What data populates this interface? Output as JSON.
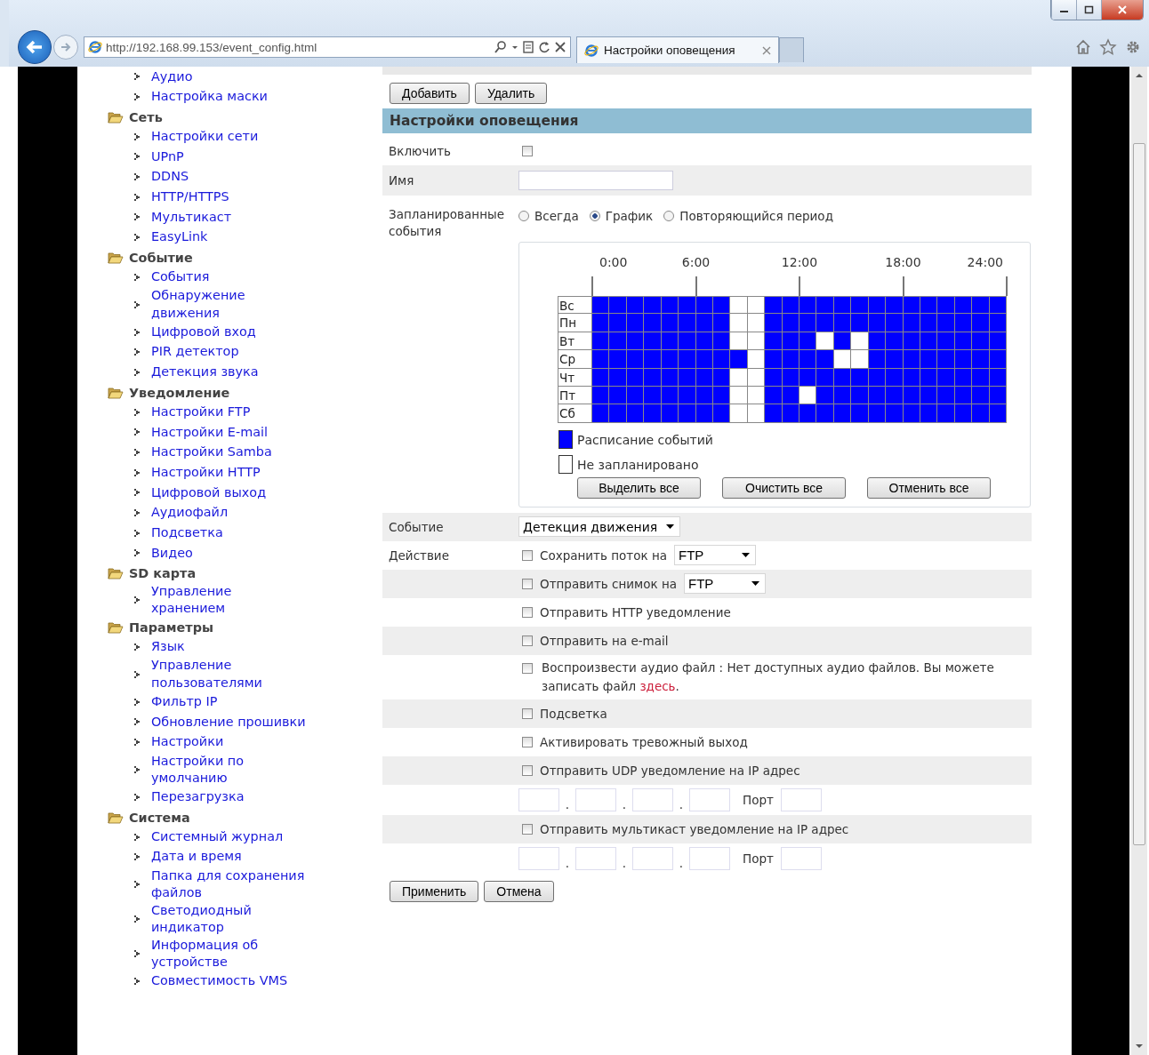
{
  "browser": {
    "address": "http://192.168.99.153/event_config.html",
    "tab": {
      "title": "Настройки оповещения"
    }
  },
  "sidebar": {
    "sections": [
      {
        "items": [
          "Аудио",
          "Настройка маски"
        ]
      },
      {
        "title": "Сеть",
        "items": [
          "Настройки сети",
          "UPnP",
          "DDNS",
          "HTTP/HTTPS",
          "Мультикаст",
          "EasyLink"
        ]
      },
      {
        "title": "Событие",
        "items": [
          "События",
          "Обнаружение движения",
          "Цифровой вход",
          "PIR детектор",
          "Детекция звука"
        ]
      },
      {
        "title": "Уведомление",
        "items": [
          "Настройки FTP",
          "Настройки E-mail",
          "Настройки Samba",
          "Настройки HTTP",
          "Цифровой выход",
          "Аудиофайл",
          "Подсветка",
          "Видео"
        ]
      },
      {
        "title": "SD карта",
        "items": [
          "Управление хранением"
        ]
      },
      {
        "title": "Параметры",
        "items": [
          "Язык",
          "Управление пользователями",
          "Фильтр IP",
          "Обновление прошивки",
          "Настройки",
          "Настройки по умолчанию",
          "Перезагрузка"
        ]
      },
      {
        "title": "Система",
        "items": [
          "Системный журнал",
          "Дата и время",
          "Папка для сохранения файлов",
          "Светодиодный индикатор",
          "Информация об устройстве",
          "Совместимость VMS"
        ]
      }
    ]
  },
  "top_buttons": [
    "Добавить",
    "Удалить"
  ],
  "section_title": "Настройки оповещения",
  "form": {
    "enable": {
      "label": "Включить",
      "checked": false
    },
    "name": {
      "label": "Имя"
    },
    "schedule": {
      "label": "Запланированные события",
      "options": [
        {
          "label": "Всегда",
          "selected": false
        },
        {
          "label": "График",
          "selected": true
        },
        {
          "label": "Повторяющийся период",
          "selected": false
        }
      ],
      "times": [
        "0:00",
        "6:00",
        "12:00",
        "18:00",
        "24:00"
      ],
      "days": [
        {
          "label": "Вс",
          "cells": [
            true,
            true,
            true,
            true,
            true,
            true,
            true,
            true,
            false,
            false,
            true,
            true,
            true,
            true,
            true,
            true,
            true,
            true,
            true,
            true,
            true,
            true,
            true,
            true
          ]
        },
        {
          "label": "Пн",
          "cells": [
            true,
            true,
            true,
            true,
            true,
            true,
            true,
            true,
            false,
            false,
            true,
            true,
            true,
            true,
            true,
            true,
            true,
            true,
            true,
            true,
            true,
            true,
            true,
            true
          ]
        },
        {
          "label": "Вт",
          "cells": [
            true,
            true,
            true,
            true,
            true,
            true,
            true,
            true,
            false,
            false,
            true,
            true,
            true,
            false,
            true,
            false,
            true,
            true,
            true,
            true,
            true,
            true,
            true,
            true
          ]
        },
        {
          "label": "Ср",
          "cells": [
            true,
            true,
            true,
            true,
            true,
            true,
            true,
            true,
            true,
            false,
            true,
            true,
            true,
            true,
            false,
            false,
            true,
            true,
            true,
            true,
            true,
            true,
            true,
            true
          ]
        },
        {
          "label": "Чт",
          "cells": [
            true,
            true,
            true,
            true,
            true,
            true,
            true,
            true,
            false,
            false,
            true,
            true,
            true,
            true,
            true,
            true,
            true,
            true,
            true,
            true,
            true,
            true,
            true,
            true
          ]
        },
        {
          "label": "Пт",
          "cells": [
            true,
            true,
            true,
            true,
            true,
            true,
            true,
            true,
            false,
            false,
            true,
            true,
            false,
            true,
            true,
            true,
            true,
            true,
            true,
            true,
            true,
            true,
            true,
            true
          ]
        },
        {
          "label": "Сб",
          "cells": [
            true,
            true,
            true,
            true,
            true,
            true,
            true,
            true,
            false,
            false,
            true,
            true,
            true,
            true,
            true,
            true,
            true,
            true,
            true,
            true,
            true,
            true,
            true,
            true
          ]
        }
      ],
      "legend": [
        {
          "label": "Расписание событий",
          "kind": "scheduled"
        },
        {
          "label": "Не запланировано",
          "kind": "unscheduled"
        }
      ],
      "buttons": [
        "Выделить все",
        "Очистить все",
        "Отменить все"
      ]
    },
    "event": {
      "label": "Событие",
      "value": "Детекция движения"
    },
    "action": {
      "label": "Действие",
      "items": [
        {
          "kind": "select",
          "label": "Сохранить поток на",
          "checked": false,
          "value": "FTP"
        },
        {
          "kind": "select",
          "label": "Отправить снимок на",
          "checked": false,
          "value": "FTP"
        },
        {
          "kind": "check",
          "label": "Отправить HTTP уведомление",
          "checked": false
        },
        {
          "kind": "check",
          "label": "Отправить на e-mail",
          "checked": false
        },
        {
          "kind": "note",
          "label": "Воспроизвести аудио файл : Нет доступных аудио файлов. Вы можете записать файл",
          "link": "здесь",
          "after": ".",
          "checked": false
        },
        {
          "kind": "check",
          "label": "Подсветка",
          "checked": false
        },
        {
          "kind": "check",
          "label": "Активировать тревожный выход",
          "checked": false
        },
        {
          "kind": "ip",
          "label": "Отправить UDP уведомление на IP адрес",
          "checked": false,
          "separators": [
            ".",
            ".",
            "."
          ],
          "port_label": "Порт"
        },
        {
          "kind": "ip",
          "label": "Отправить мультикаст уведомление на IP адрес",
          "checked": false,
          "separators": [
            ".",
            ".",
            "."
          ],
          "port_label": "Порт"
        }
      ]
    }
  },
  "bottom_buttons": [
    "Применить",
    "Отмена"
  ]
}
